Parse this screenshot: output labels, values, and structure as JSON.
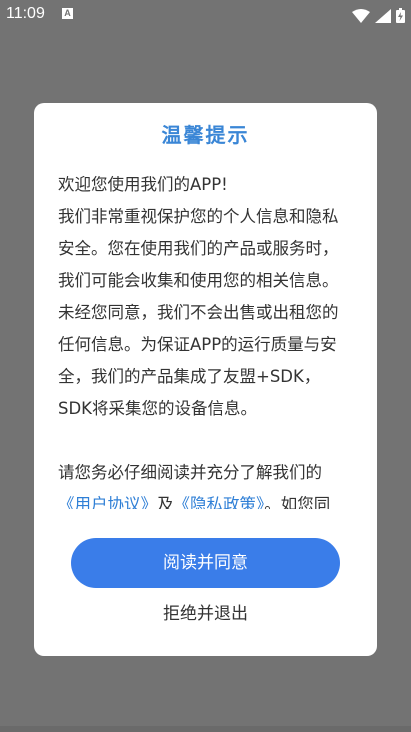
{
  "status_bar": {
    "time": "11:09",
    "notification_glyph": "A",
    "icons": [
      "wifi-icon",
      "signal-icon",
      "battery-icon"
    ]
  },
  "dialog": {
    "title": "温馨提示",
    "paragraph1": "欢迎您使用我们的APP!",
    "paragraph2": "我们非常重视保护您的个人信息和隐私安全。您在使用我们的产品或服务时，我们可能会收集和使用您的相关信息。未经您同意，我们不会出售或出租您的任何信息。为保证APP的运行质量与安全，我们的产品集成了友盟+SDK，SDK将采集您的设备信息。",
    "paragraph3_prefix": "请您务必仔细阅读并充分了解我们的",
    "user_agreement_link": "《用户协议》",
    "and_text": "及",
    "privacy_policy_link": "《隐私政策》",
    "paragraph3_suffix": "。如您同",
    "agree_button": "阅读并同意",
    "refuse_button": "拒绝并退出"
  },
  "colors": {
    "overlay": "#737373",
    "title": "#3a86d6",
    "link": "#2f7fd6",
    "primary_button": "#3a7de9"
  }
}
